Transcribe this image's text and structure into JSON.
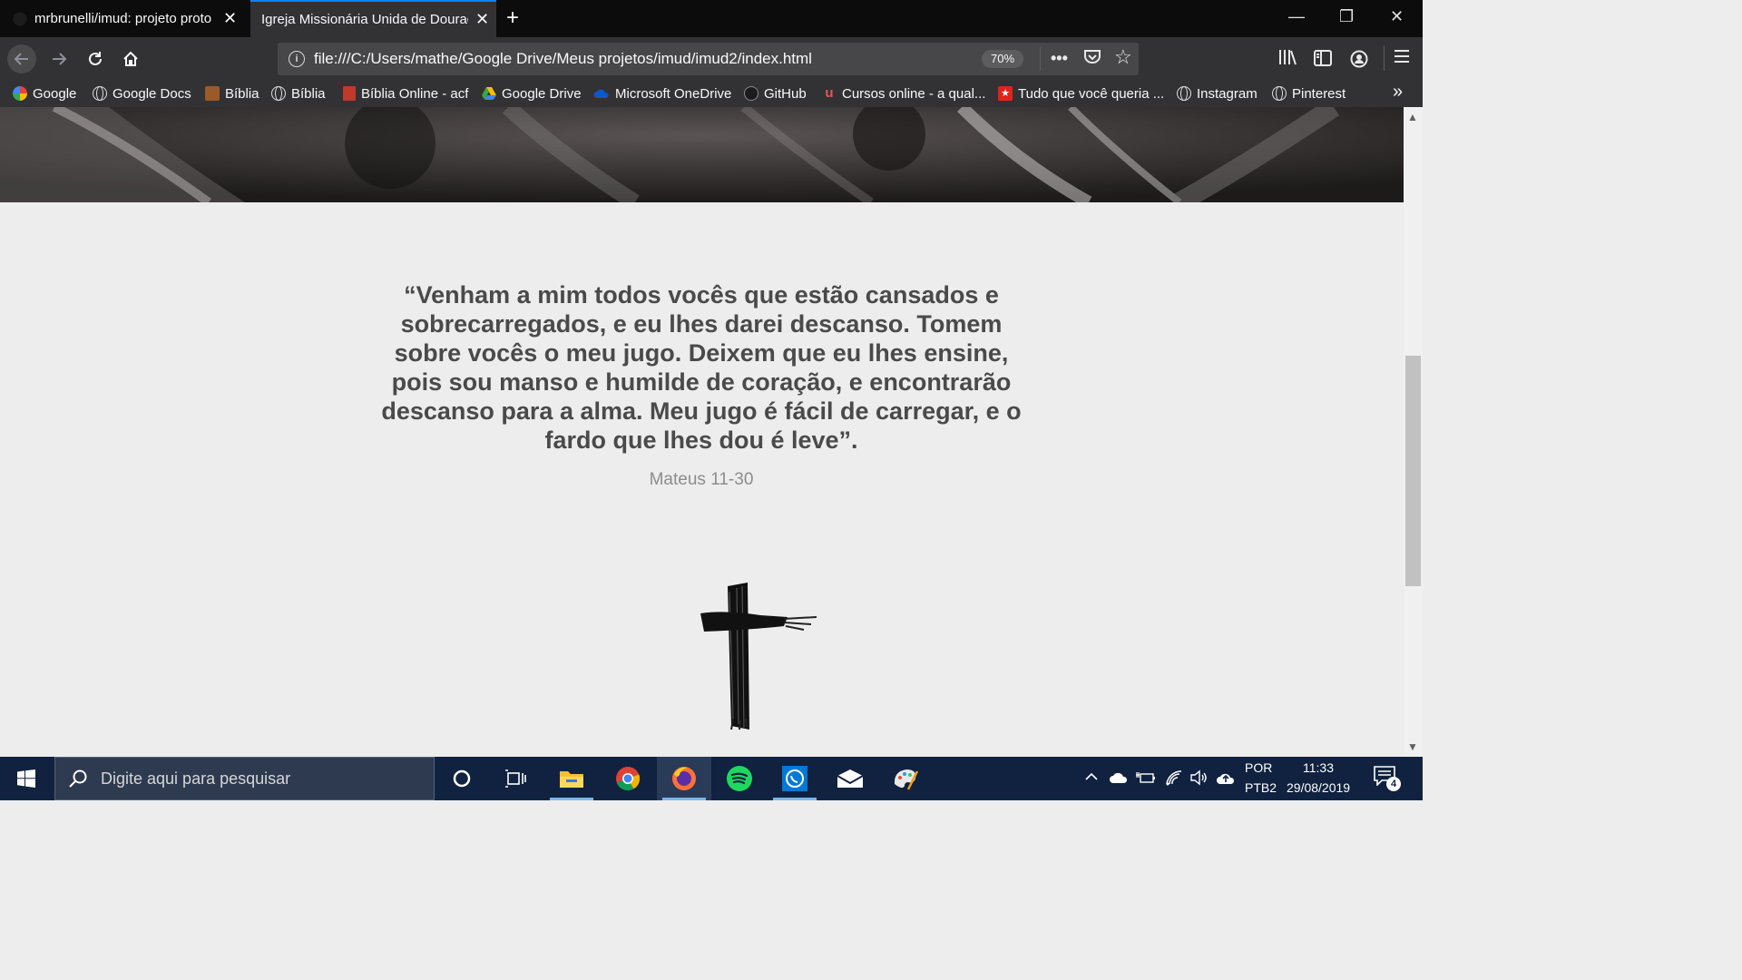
{
  "tabs": [
    {
      "title": "mrbrunelli/imud: projeto proto",
      "active": false
    },
    {
      "title": "Igreja Missionária Unida de Dourad",
      "active": true
    }
  ],
  "window_controls": {
    "minimize": "—",
    "restore": "❐",
    "close": "✕"
  },
  "nav": {
    "url": "file:///C:/Users/mathe/Google Drive/Meus projetos/imud/imud2/index.html",
    "zoom": "70%"
  },
  "bookmarks": [
    {
      "label": "Google",
      "icon": "google-icon"
    },
    {
      "label": "Google Docs",
      "icon": "globe-icon"
    },
    {
      "label": "Bíblia",
      "icon": "bible-book-icon"
    },
    {
      "label": "Bíblia",
      "icon": "globe-icon"
    },
    {
      "label": "Bíblia Online - acf",
      "icon": "bookmark-red-icon"
    },
    {
      "label": "Google Drive",
      "icon": "google-drive-icon"
    },
    {
      "label": "Microsoft OneDrive",
      "icon": "onedrive-icon"
    },
    {
      "label": "GitHub",
      "icon": "github-icon"
    },
    {
      "label": "Cursos online - a qual...",
      "icon": "udemy-icon"
    },
    {
      "label": "Tudo que você queria ...",
      "icon": "star-red-icon"
    },
    {
      "label": "Instagram",
      "icon": "globe-icon"
    },
    {
      "label": "Pinterest",
      "icon": "globe-icon"
    }
  ],
  "page": {
    "quote": "“Venham a mim todos vocês que estão cansados e sobrecarregados, e eu lhes darei descanso. Tomem sobre vocês o meu jugo. Deixem que eu lhes ensine, pois sou manso e humilde de coração, e encontrarão descanso para a alma. Meu jugo é fácil de carregar, e o fardo que lhes dou é leve”.",
    "reference": "Mateus 11-30"
  },
  "taskbar": {
    "search_placeholder": "Digite aqui para pesquisar",
    "language_1": "POR",
    "language_2": "PTB2",
    "time": "11:33",
    "date": "29/08/2019",
    "notification_count": "4"
  },
  "colors": {
    "tab_active_accent": "#0a84ff",
    "page_background": "#ededed",
    "quote_text": "#4a4a4a",
    "taskbar": "#10223f"
  }
}
